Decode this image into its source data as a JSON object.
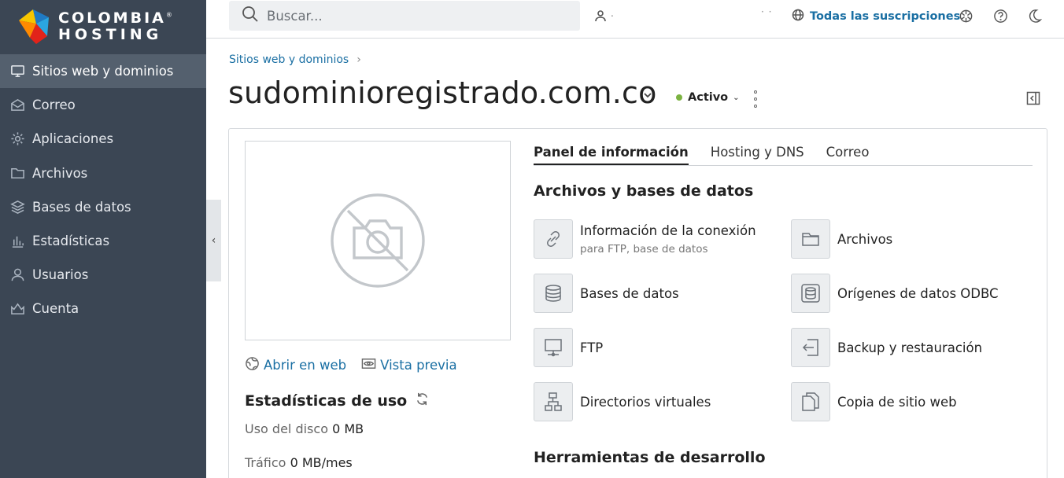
{
  "brand": {
    "line1": "COLOMBIA",
    "line2": "HOSTING",
    "registered": "®"
  },
  "sidebar": {
    "items": [
      {
        "label": "Sitios web y dominios",
        "icon": "monitor-icon",
        "active": true
      },
      {
        "label": "Correo",
        "icon": "mail-icon"
      },
      {
        "label": "Aplicaciones",
        "icon": "gear-icon"
      },
      {
        "label": "Archivos",
        "icon": "folder-icon"
      },
      {
        "label": "Bases de datos",
        "icon": "database-layers-icon"
      },
      {
        "label": "Estadísticas",
        "icon": "bar-chart-icon"
      },
      {
        "label": "Usuarios",
        "icon": "user-icon"
      },
      {
        "label": "Cuenta",
        "icon": "account-icon"
      }
    ]
  },
  "topbar": {
    "search_placeholder": "Buscar...",
    "user_text": ".",
    "extra_dots": "· ·",
    "subscriptions": "Todas las suscripciones"
  },
  "breadcrumb": {
    "item": "Sitios web y dominios"
  },
  "domain": {
    "name": "sudominioregistrado.com.co",
    "status": "Activo",
    "status_color": "#7cb342"
  },
  "preview_links": {
    "open_web": "Abrir en web",
    "preview": "Vista previa"
  },
  "stats": {
    "title": "Estadísticas de uso",
    "disk_label": "Uso del disco",
    "disk_value": "0 MB",
    "traffic_label": "Tráfico",
    "traffic_value": "0 MB/mes"
  },
  "tabs": [
    "Panel de información",
    "Hosting y DNS",
    "Correo"
  ],
  "sections": {
    "files_db": "Archivos y bases de datos",
    "dev_tools": "Herramientas de desarrollo"
  },
  "tools": [
    {
      "name": "Información de la conexión",
      "sub": "para FTP, base de datos",
      "icon": "connection-icon"
    },
    {
      "name": "Archivos",
      "icon": "folder-icon"
    },
    {
      "name": "Bases de datos",
      "icon": "database-icon"
    },
    {
      "name": "Orígenes de datos ODBC",
      "icon": "odbc-icon"
    },
    {
      "name": "FTP",
      "icon": "ftp-icon"
    },
    {
      "name": "Backup y restauración",
      "icon": "backup-icon"
    },
    {
      "name": "Directorios virtuales",
      "icon": "virtual-directories-icon"
    },
    {
      "name": "Copia de sitio web",
      "icon": "copy-icon"
    }
  ],
  "colors": {
    "sidebar_bg": "#3b4654",
    "active_bg": "#54606e",
    "link": "#1a6fa3"
  }
}
